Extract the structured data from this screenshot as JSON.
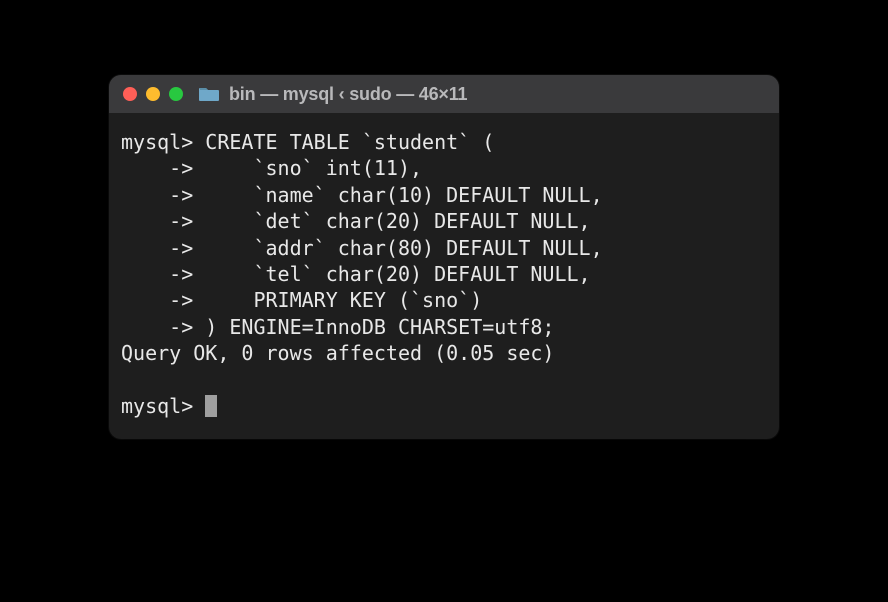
{
  "window": {
    "title": "bin — mysql ‹ sudo — 46×11"
  },
  "terminal": {
    "lines": [
      "mysql> CREATE TABLE `student` (",
      "    ->     `sno` int(11),",
      "    ->     `name` char(10) DEFAULT NULL,",
      "    ->     `det` char(20) DEFAULT NULL,",
      "    ->     `addr` char(80) DEFAULT NULL,",
      "    ->     `tel` char(20) DEFAULT NULL,",
      "    ->     PRIMARY KEY (`sno`)",
      "    -> ) ENGINE=InnoDB CHARSET=utf8;",
      "Query OK, 0 rows affected (0.05 sec)",
      "",
      "mysql> "
    ]
  }
}
